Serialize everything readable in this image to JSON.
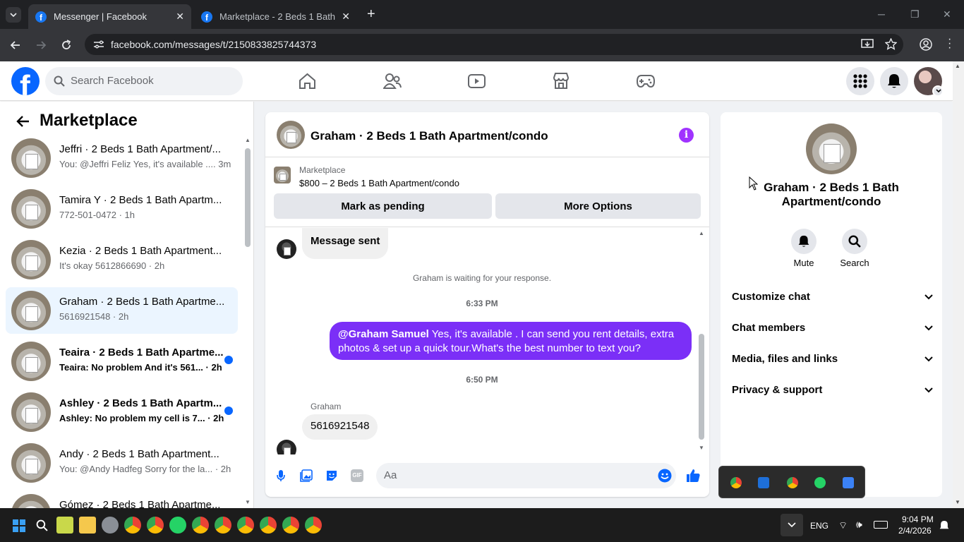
{
  "browser": {
    "tabs": [
      {
        "title": "Messenger | Facebook"
      },
      {
        "title": "Marketplace - 2 Beds 1 Bath Ap"
      }
    ],
    "url": "facebook.com/messages/t/2150833825744373"
  },
  "fb": {
    "search_placeholder": "Search Facebook"
  },
  "sidebar": {
    "title": "Marketplace",
    "conversations": [
      {
        "name": "Jeffri · 2 Beds 1 Bath Apartment/...",
        "preview": "You: @Jeffri Feliz Yes, it's available .... 3m",
        "unread": false
      },
      {
        "name": "Tamira Y · 2 Beds 1 Bath Apartm...",
        "preview": "772-501-0472 · 1h",
        "unread": false
      },
      {
        "name": "Kezia · 2 Beds 1 Bath Apartment...",
        "preview": "It's okay 5612866690 · 2h",
        "unread": false
      },
      {
        "name": "Graham · 2 Beds 1 Bath Apartme...",
        "preview": "5616921548 · 2h",
        "unread": false
      },
      {
        "name": "Teaira · 2 Beds 1 Bath Apartme...",
        "preview": "Teaira: No problem And it's 561... · 2h",
        "unread": true
      },
      {
        "name": "Ashley · 2 Beds 1 Bath Apartm...",
        "preview": "Ashley: No problem my cell is 7... · 2h",
        "unread": true
      },
      {
        "name": "Andy · 2 Beds 1 Bath Apartment...",
        "preview": "You: @Andy Hadfeg Sorry for the la... · 2h",
        "unread": false
      },
      {
        "name": "Gómez · 2 Beds 1 Bath Apartme...",
        "preview": "",
        "unread": false
      }
    ]
  },
  "chat": {
    "header_title": "Graham · 2 Beds 1 Bath Apartment/condo",
    "listing_label": "Marketplace",
    "listing_title": "$800 – 2 Beds 1 Bath Apartment/condo",
    "mark_pending": "Mark as pending",
    "more_options": "More Options",
    "msg_sent": "Message sent",
    "waiting": "Graham is waiting for your response.",
    "time1": "6:33 PM",
    "out_mention": "@Graham Samuel",
    "out_text": " Yes, it's available .  I can send you rent details, extra photos & set up a quick tour.What's the best number to text you?",
    "time2": "6:50 PM",
    "sender": "Graham",
    "in_text": "5616921548",
    "composer_placeholder": "Aa"
  },
  "info": {
    "title": "Graham · 2 Beds 1 Bath Apartment/condo",
    "mute": "Mute",
    "search": "Search",
    "sections": [
      "Customize chat",
      "Chat members",
      "Media, files and links",
      "Privacy & support"
    ]
  },
  "taskbar": {
    "lang": "ENG",
    "time": "9:04 PM",
    "date": "2/4/2026"
  },
  "colors": {
    "fb_blue": "#0866ff",
    "outgoing_bubble": "#7b2ff7",
    "accent_purple": "#a033ff"
  }
}
